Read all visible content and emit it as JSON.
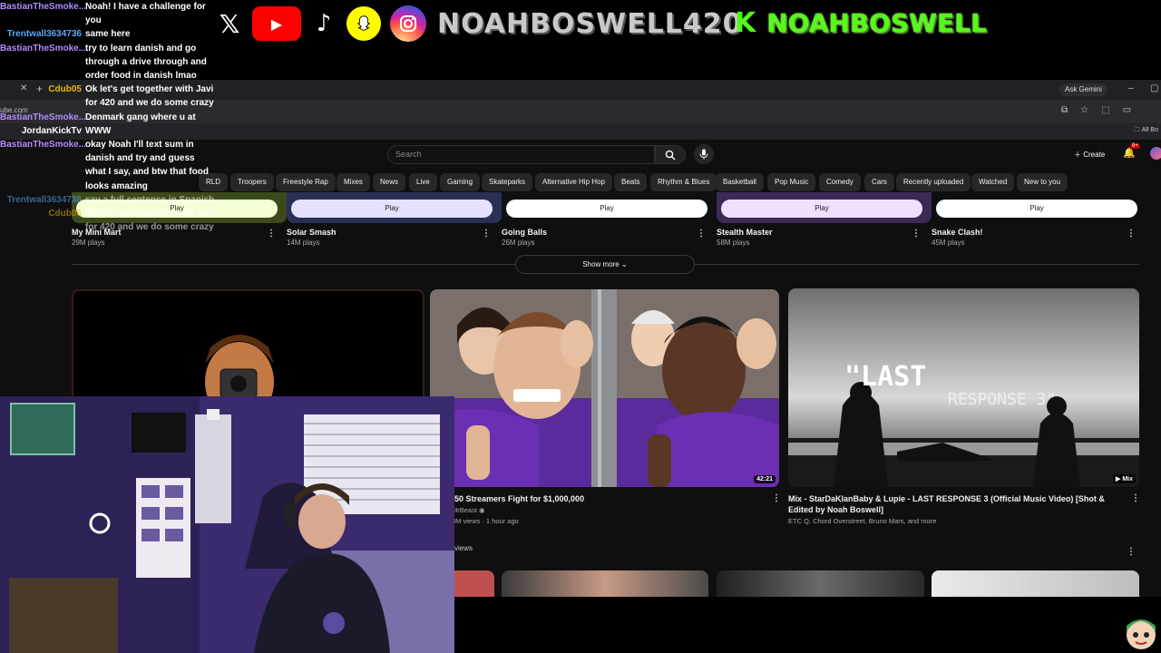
{
  "overlay": {
    "socials": [
      "x-icon",
      "youtube-icon",
      "tiktok-icon",
      "snapchat-icon",
      "instagram-icon"
    ],
    "handle": "NOAHBOSWELL420",
    "kick_letter": "K",
    "kick_handle": "NOAHBOSWELL",
    "chat": [
      {
        "user": "BastianTheSmoke...",
        "color": "#b48cff",
        "msg": "Noah! I have a challenge for you"
      },
      {
        "user": "Trentwall3634736",
        "color": "#5aa9ff",
        "msg": "same here"
      },
      {
        "user": "BastianTheSmoke...",
        "color": "#b48cff",
        "msg": "try to learn danish and go through a drive through and order food in danish lmao"
      },
      {
        "user": "Cdub05",
        "color": "#f0b400",
        "msg": "Ok let's get together with Javi for 420 and we do some crazy"
      },
      {
        "user": "BastianTheSmoke...",
        "color": "#b48cff",
        "msg": "Denmark gang where u at"
      },
      {
        "user": "JordanKickTv",
        "color": "#ffffff",
        "msg": "WWW"
      },
      {
        "user": "BastianTheSmoke...",
        "color": "#b48cff",
        "msg": "okay Noah I'll text sum in danish and try and guess what I say, and btw that food looks amazing"
      },
      {
        "user": "Trentwall3634736",
        "color": "#5aa9ff",
        "msg": "say a full sentence in Spanish"
      },
      {
        "user": "Cdub05",
        "color": "#f0b400",
        "msg": "Ok let's get together with Javi for 420 and we do some crazy"
      }
    ]
  },
  "browser": {
    "url_fragment": "ube.com",
    "ask_gemini": "Ask Gemini",
    "all_bookmarks": "All Bo"
  },
  "youtube": {
    "search_placeholder": "Search",
    "create_label": "Create",
    "notif_badge": "9+",
    "chips": [
      "RLD",
      "Troopers",
      "Freestyle Rap",
      "Mixes",
      "News",
      "Live",
      "Gaming",
      "Skateparks",
      "Alternative Hip Hop",
      "Beats",
      "Rhythm & Blues",
      "Basketball",
      "Pop Music",
      "Comedy",
      "Cars",
      "Recently uploaded",
      "Watched",
      "New to you"
    ],
    "games": [
      {
        "title": "My Mini Mart",
        "plays": "29M plays",
        "play": "Play"
      },
      {
        "title": "Solar Smash",
        "plays": "14M plays",
        "play": "Play"
      },
      {
        "title": "Going Balls",
        "plays": "26M plays",
        "play": "Play"
      },
      {
        "title": "Stealth Master",
        "plays": "58M plays",
        "play": "Play"
      },
      {
        "title": "Snake Clash!",
        "plays": "45M plays",
        "play": "Play"
      }
    ],
    "show_more": "Show more",
    "videos": [
      {
        "title": "50 Streamers Fight for $1,000,000",
        "channel": "MrBeast",
        "meta": "3M views · 1 hour ago",
        "duration": "42:21"
      },
      {
        "title": "Mix - StarDaKlanBaby & Lupie - LAST RESPONSE 3 (Official Music Video) [Shot & Edited by Noah Boswell]",
        "meta": "ETC Q, Chord Overstreet, Bruno Mars, and more",
        "badge": "Mix",
        "thumb_text_1": "\"LAST",
        "thumb_text_2": "RESPONSE 3\""
      }
    ],
    "partial_views": "views"
  },
  "colors": {
    "kick_green": "#53fc18",
    "yt_red": "#ff0000",
    "bg": "#0f0f0f"
  }
}
